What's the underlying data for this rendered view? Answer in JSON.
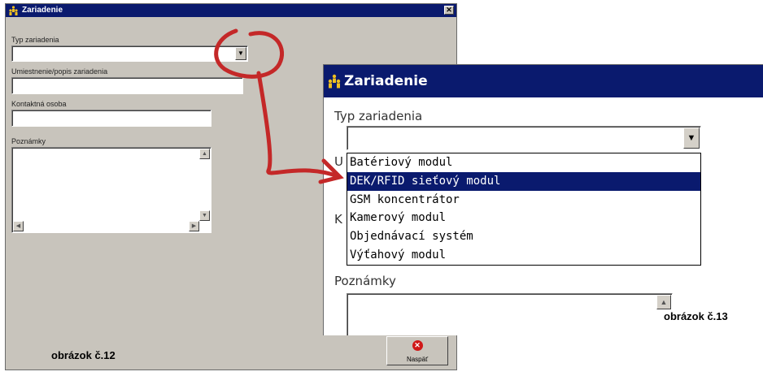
{
  "left_window": {
    "title": "Zariadenie",
    "close_glyph": "✕",
    "type_label": "Typ zariadenia",
    "location_label": "Umiestnenie/popis zariadenia",
    "contact_label": "Kontaktná osoba",
    "notes_label": "Poznámky",
    "back_button": "Naspäť",
    "caption": "obrázok č.12"
  },
  "right_window": {
    "title": "Zariadenie",
    "type_label": "Typ zariadenia",
    "notes_label": "Poznámky",
    "caption": "obrázok č.13",
    "dropdown_options": [
      "Batériový modul",
      "DEK/RFID sieťový modul",
      "GSM koncentrátor",
      "Kamerový modul",
      "Objednávací systém",
      "Výťahový modul"
    ],
    "selected_option": "DEK/RFID sieťový modul",
    "partial_labels": [
      "U",
      "K"
    ]
  },
  "colors": {
    "title_bar": "#0a1a6e",
    "window_face": "#c8c4bc",
    "annotation": "#c42828"
  },
  "icons": {
    "app": "app-people-icon",
    "close": "close-icon",
    "dropdown": "chevron-down-icon",
    "cancel": "red-x-icon"
  }
}
